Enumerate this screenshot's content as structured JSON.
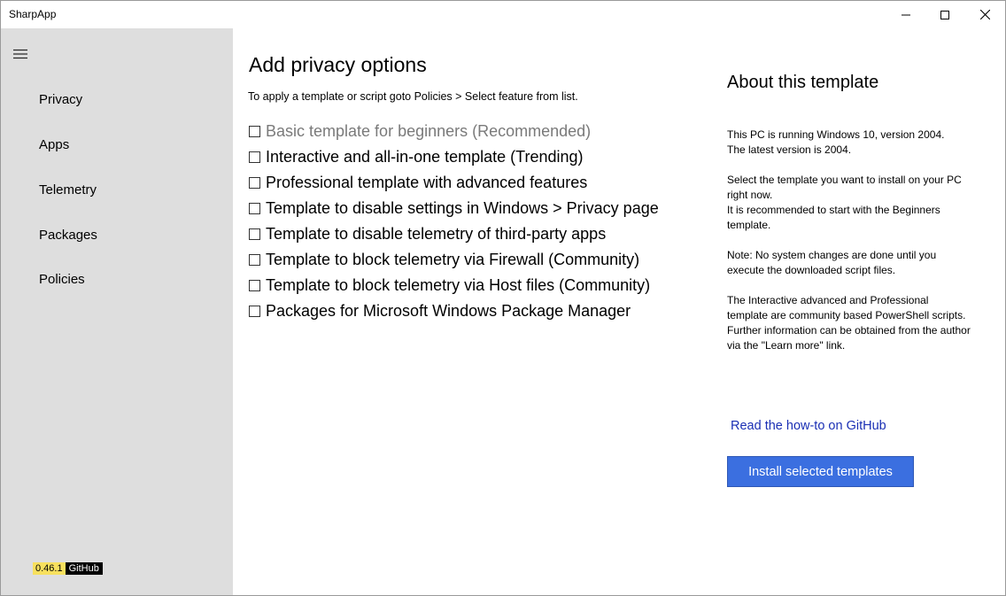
{
  "window": {
    "title": "SharpApp"
  },
  "sidebar": {
    "menu_icon": "hamburger-menu-icon",
    "items": [
      {
        "label": "Privacy"
      },
      {
        "label": "Apps"
      },
      {
        "label": "Telemetry"
      },
      {
        "label": "Packages"
      },
      {
        "label": "Policies"
      }
    ],
    "version": "0.46.1",
    "github_label": "GitHub"
  },
  "main": {
    "title": "Add privacy options",
    "instruction": "To apply a template or script goto Policies > Select feature from list.",
    "options": [
      {
        "label": "Basic template for beginners (Recommended)",
        "checked": false,
        "dimmed": true
      },
      {
        "label": "Interactive and all-in-one template (Trending)",
        "checked": false
      },
      {
        "label": "Professional template with advanced features",
        "checked": false
      },
      {
        "label": "Template to disable settings in Windows > Privacy page",
        "checked": false
      },
      {
        "label": "Template to disable telemetry of third-party apps",
        "checked": false
      },
      {
        "label": "Template to block telemetry via Firewall (Community)",
        "checked": false
      },
      {
        "label": "Template to block telemetry via Host files (Community)",
        "checked": false
      },
      {
        "label": "Packages for Microsoft Windows Package Manager",
        "checked": false
      }
    ]
  },
  "about": {
    "title": "About this template",
    "paragraphs": [
      "This PC is running Windows 10, version 2004.\nThe latest version is 2004.",
      "Select the template you want to install on your PC right now.\nIt is recommended to start with the Beginners template.",
      "Note: No system changes are done until you execute the downloaded script files.",
      "The Interactive advanced and Professional template are community based PowerShell scripts. Further information can be obtained from the author via the \"Learn more\" link."
    ],
    "link_label": "Read the how-to on GitHub",
    "install_button_label": "Install selected templates"
  },
  "colors": {
    "sidebar_bg": "#dedede",
    "accent_button": "#3b6fe0",
    "link": "#1a2fb4",
    "version_badge": "#f7e05e",
    "dimmed_text": "#7a7a7a"
  }
}
